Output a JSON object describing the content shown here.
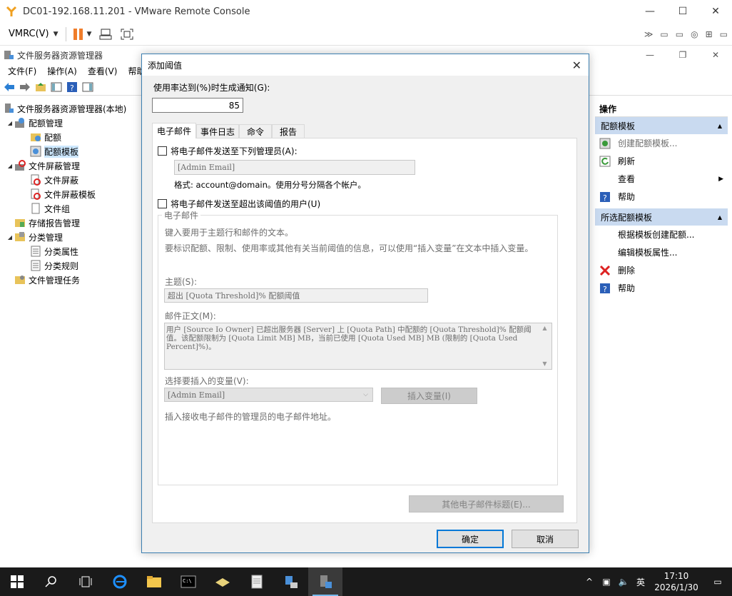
{
  "vmrc": {
    "title": "DC01-192.168.11.201 - VMware Remote Console",
    "menu_label": "VMRC(V)"
  },
  "mmc": {
    "title": "文件服务器资源管理器",
    "menu": [
      "文件(F)",
      "操作(A)",
      "查看(V)",
      "帮助"
    ]
  },
  "tree": [
    {
      "label": "文件服务器资源管理器(本地)",
      "level": 0,
      "expander": "",
      "icon": "server-icon"
    },
    {
      "label": "配额管理",
      "level": 1,
      "expander": "◢",
      "icon": "quota-management-icon"
    },
    {
      "label": "配额",
      "level": 2,
      "expander": "",
      "icon": "quota-icon"
    },
    {
      "label": "配额模板",
      "level": 2,
      "expander": "",
      "icon": "quota-template-icon",
      "selected": true
    },
    {
      "label": "文件屏蔽管理",
      "level": 1,
      "expander": "◢",
      "icon": "file-screen-management-icon"
    },
    {
      "label": "文件屏蔽",
      "level": 2,
      "expander": "",
      "icon": "file-screen-icon"
    },
    {
      "label": "文件屏蔽模板",
      "level": 2,
      "expander": "",
      "icon": "file-screen-template-icon"
    },
    {
      "label": "文件组",
      "level": 2,
      "expander": "",
      "icon": "file-group-icon"
    },
    {
      "label": "存储报告管理",
      "level": 1,
      "expander": "",
      "icon": "storage-report-icon"
    },
    {
      "label": "分类管理",
      "level": 1,
      "expander": "◢",
      "icon": "classification-icon"
    },
    {
      "label": "分类属性",
      "level": 2,
      "expander": "",
      "icon": "classification-property-icon"
    },
    {
      "label": "分类规则",
      "level": 2,
      "expander": "",
      "icon": "classification-rule-icon"
    },
    {
      "label": "文件管理任务",
      "level": 1,
      "expander": "",
      "icon": "file-management-task-icon"
    }
  ],
  "actions": {
    "header": "操作",
    "section1": {
      "title": "配额模板",
      "items": [
        {
          "label": "创建配额模板...",
          "icon": "create-quota-template-icon",
          "dim": true
        },
        {
          "label": "刷新",
          "icon": "refresh-icon"
        },
        {
          "label": "查看",
          "icon": "",
          "submenu": true
        },
        {
          "label": "帮助",
          "icon": "help-icon"
        }
      ]
    },
    "section2": {
      "title": "所选配额模板",
      "items": [
        {
          "label": "根据模板创建配额...",
          "icon": ""
        },
        {
          "label": "编辑模板属性...",
          "icon": ""
        },
        {
          "label": "删除",
          "icon": "delete-icon"
        },
        {
          "label": "帮助",
          "icon": "help-icon"
        }
      ]
    }
  },
  "dialog": {
    "title": "添加阈值",
    "usage_label": "使用率达到(%)时生成通知(G):",
    "usage_value": "85",
    "tabs": [
      "电子邮件",
      "事件日志",
      "命令",
      "报告"
    ],
    "email_admins_label": "将电子邮件发送至下列管理员(A):",
    "admin_email_value": "[Admin Email]",
    "format_hint": "格式: account@domain。使用分号分隔各个帐户。",
    "email_user_label": "将电子邮件发送至超出该阈值的用户(U)",
    "group_label": "电子邮件",
    "group_desc1": "键入要用于主题行和邮件的文本。",
    "group_desc2": "要标识配额、限制、使用率或其他有关当前阈值的信息，可以使用“插入变量”在文本中插入变量。",
    "subject_label": "主题(S):",
    "subject_value": "超出 [Quota Threshold]% 配额阈值",
    "body_label": "邮件正文(M):",
    "body_value": "用户 [Source Io Owner] 已超出服务器 [Server] 上 [Quota Path] 中配额的 [Quota Threshold]% 配额阈值。该配额限制为 [Quota Limit MB] MB，当前已使用 [Quota Used MB] MB (限制的 [Quota Used Percent]%)。",
    "variable_label": "选择要插入的变量(V):",
    "variable_value": "[Admin Email]",
    "insert_variable_button": "插入变量(I)",
    "variable_desc": "插入接收电子邮件的管理员的电子邮件地址。",
    "other_headers_button": "其他电子邮件标题(E)...",
    "ok_button": "确定",
    "cancel_button": "取消"
  },
  "taskbar": {
    "time": "17:10",
    "date": "2026/1/30",
    "ime": "英"
  },
  "colors": {
    "accent": "#0078d7",
    "dialog_border": "#3c7fb1",
    "selection": "#cde8ff",
    "actions_section": "#c9daf0",
    "pause_orange": "#f07d2a",
    "taskbar": "#1a1a1a"
  }
}
